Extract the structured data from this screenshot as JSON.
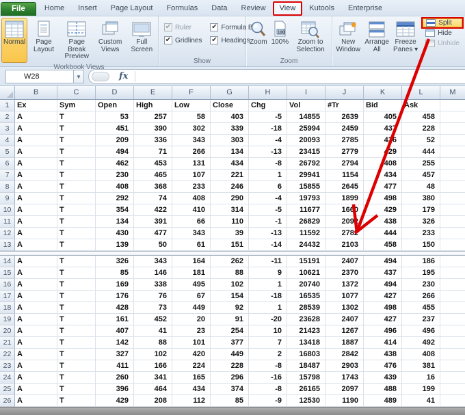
{
  "tabs": {
    "file": "File",
    "items": [
      "Home",
      "Insert",
      "Page Layout",
      "Formulas",
      "Data",
      "Review",
      "View",
      "Kutools",
      "Enterprise"
    ],
    "active": "View"
  },
  "ribbon": {
    "workbook_views": {
      "label": "Workbook Views",
      "buttons": [
        "Normal",
        "Page Layout",
        "Page Break Preview",
        "Custom Views",
        "Full Screen"
      ],
      "selected": "Normal"
    },
    "show": {
      "label": "Show",
      "checkboxes": [
        {
          "label": "Ruler",
          "checked": true,
          "disabled": true
        },
        {
          "label": "Formula Bar",
          "checked": true,
          "disabled": false
        },
        {
          "label": "Gridlines",
          "checked": true,
          "disabled": false
        },
        {
          "label": "Headings",
          "checked": true,
          "disabled": false
        }
      ]
    },
    "zoom": {
      "label": "Zoom",
      "buttons": [
        "Zoom",
        "100%",
        "Zoom to Selection"
      ]
    },
    "window": {
      "label": "",
      "buttons": [
        "New Window",
        "Arrange All",
        "Freeze Panes ▾"
      ],
      "side_buttons": [
        {
          "label": "Split",
          "highlighted": true,
          "disabled": false
        },
        {
          "label": "Hide",
          "highlighted": false,
          "disabled": false
        },
        {
          "label": "Unhide",
          "highlighted": false,
          "disabled": true
        }
      ]
    }
  },
  "formula_bar": {
    "name_box": "W28",
    "fx": "fx",
    "formula": ""
  },
  "annotations": {
    "highlight_color": "#dd0000"
  },
  "sheet": {
    "column_letters": [
      "B",
      "C",
      "D",
      "E",
      "F",
      "G",
      "H",
      "I",
      "J",
      "K",
      "L",
      "M"
    ],
    "header_row": {
      "row": 1,
      "cells": [
        "Ex",
        "Sym",
        "Open",
        "High",
        "Low",
        "Close",
        "Chg",
        "Vol",
        "#Tr",
        "Bid",
        "Ask",
        ""
      ]
    },
    "top_rows": [
      {
        "row": 2,
        "cells": [
          "A",
          "T",
          53,
          257,
          58,
          403,
          -5,
          14855,
          2639,
          405,
          458,
          ""
        ]
      },
      {
        "row": 3,
        "cells": [
          "A",
          "T",
          451,
          390,
          302,
          339,
          -18,
          25994,
          2459,
          437,
          228,
          ""
        ]
      },
      {
        "row": 4,
        "cells": [
          "A",
          "T",
          209,
          336,
          343,
          303,
          -4,
          20093,
          2785,
          436,
          52,
          ""
        ]
      },
      {
        "row": 5,
        "cells": [
          "A",
          "T",
          494,
          71,
          266,
          134,
          -13,
          23415,
          2779,
          429,
          444,
          ""
        ]
      },
      {
        "row": 6,
        "cells": [
          "A",
          "T",
          462,
          453,
          131,
          434,
          -8,
          26792,
          2794,
          408,
          255,
          ""
        ]
      },
      {
        "row": 7,
        "cells": [
          "A",
          "T",
          230,
          465,
          107,
          221,
          1,
          29941,
          1154,
          434,
          457,
          ""
        ]
      },
      {
        "row": 8,
        "cells": [
          "A",
          "T",
          408,
          368,
          233,
          246,
          6,
          15855,
          2645,
          477,
          48,
          ""
        ]
      },
      {
        "row": 9,
        "cells": [
          "A",
          "T",
          292,
          74,
          408,
          290,
          -4,
          19793,
          1899,
          498,
          380,
          ""
        ]
      },
      {
        "row": 10,
        "cells": [
          "A",
          "T",
          354,
          422,
          410,
          314,
          -5,
          11677,
          1660,
          429,
          179,
          ""
        ]
      },
      {
        "row": 11,
        "cells": [
          "A",
          "T",
          134,
          391,
          66,
          110,
          -1,
          26829,
          2092,
          438,
          326,
          ""
        ]
      },
      {
        "row": 12,
        "cells": [
          "A",
          "T",
          430,
          477,
          343,
          39,
          -13,
          11592,
          2782,
          444,
          233,
          ""
        ]
      },
      {
        "row": 13,
        "cells": [
          "A",
          "T",
          139,
          50,
          61,
          151,
          -14,
          24432,
          2103,
          458,
          150,
          ""
        ]
      }
    ],
    "bottom_rows": [
      {
        "row": 14,
        "cells": [
          "A",
          "T",
          326,
          343,
          164,
          262,
          -11,
          15191,
          2407,
          494,
          186,
          ""
        ]
      },
      {
        "row": 15,
        "cells": [
          "A",
          "T",
          85,
          146,
          181,
          88,
          9,
          10621,
          2370,
          437,
          195,
          ""
        ]
      },
      {
        "row": 16,
        "cells": [
          "A",
          "T",
          169,
          338,
          495,
          102,
          1,
          20740,
          1372,
          494,
          230,
          ""
        ]
      },
      {
        "row": 17,
        "cells": [
          "A",
          "T",
          176,
          76,
          67,
          154,
          -18,
          16535,
          1077,
          427,
          266,
          ""
        ]
      },
      {
        "row": 18,
        "cells": [
          "A",
          "T",
          428,
          73,
          449,
          92,
          1,
          28539,
          1302,
          498,
          455,
          ""
        ]
      },
      {
        "row": 19,
        "cells": [
          "A",
          "T",
          161,
          452,
          20,
          91,
          -20,
          23628,
          2407,
          427,
          237,
          ""
        ]
      },
      {
        "row": 20,
        "cells": [
          "A",
          "T",
          407,
          41,
          23,
          254,
          10,
          21423,
          1267,
          496,
          496,
          ""
        ]
      },
      {
        "row": 21,
        "cells": [
          "A",
          "T",
          142,
          88,
          101,
          377,
          7,
          13418,
          1887,
          414,
          492,
          ""
        ]
      },
      {
        "row": 22,
        "cells": [
          "A",
          "T",
          327,
          102,
          420,
          449,
          2,
          16803,
          2842,
          438,
          408,
          ""
        ]
      },
      {
        "row": 23,
        "cells": [
          "A",
          "T",
          411,
          166,
          224,
          228,
          -8,
          18487,
          2903,
          476,
          381,
          ""
        ]
      },
      {
        "row": 24,
        "cells": [
          "A",
          "T",
          260,
          341,
          165,
          296,
          -16,
          15798,
          1743,
          439,
          16,
          ""
        ]
      },
      {
        "row": 25,
        "cells": [
          "A",
          "T",
          396,
          464,
          434,
          374,
          -8,
          26165,
          2097,
          488,
          199,
          ""
        ]
      },
      {
        "row": 26,
        "cells": [
          "A",
          "T",
          429,
          208,
          112,
          85,
          -9,
          12530,
          1190,
          489,
          41,
          ""
        ]
      }
    ]
  }
}
